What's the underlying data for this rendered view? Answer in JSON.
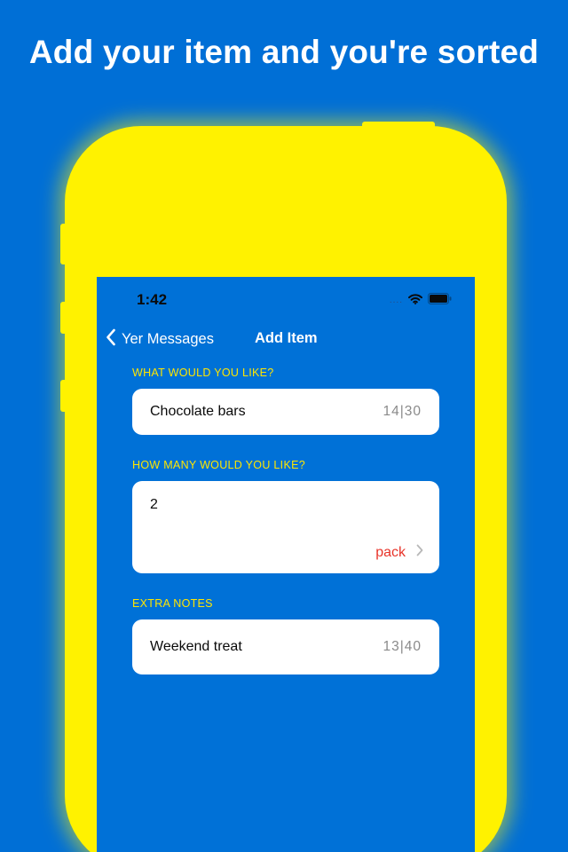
{
  "promo": {
    "headline": "Add your item and you're sorted"
  },
  "status_bar": {
    "time": "1:42",
    "signal_icon": "signal-dots-icon",
    "wifi_icon": "wifi-icon",
    "battery_icon": "battery-icon",
    "signal_text": "...."
  },
  "nav": {
    "back_label": "Yer Messages",
    "back_icon": "chevron-left-icon",
    "title": "Add Item"
  },
  "form": {
    "item": {
      "label": "WHAT WOULD YOU LIKE?",
      "value": "Chocolate bars",
      "counter": "14|30"
    },
    "quantity": {
      "label": "HOW MANY WOULD YOU LIKE?",
      "value": "2",
      "unit": "pack",
      "unit_icon": "chevron-right-icon"
    },
    "notes": {
      "label": "EXTRA NOTES",
      "value": "Weekend treat",
      "counter": "13|40"
    }
  },
  "colors": {
    "background": "#006fd6",
    "phone_frame": "#fff200",
    "screen": "#0071d7",
    "label_accent": "#ffe600",
    "unit_accent": "#e8342a"
  }
}
